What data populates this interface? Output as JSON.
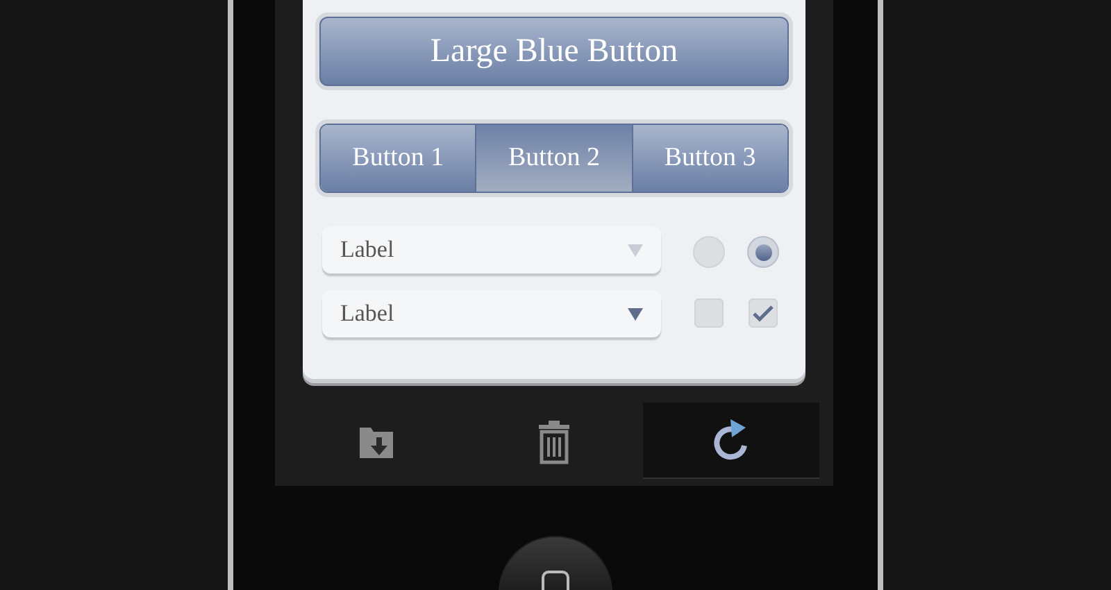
{
  "large_button": {
    "label": "Large Blue Button"
  },
  "segmented": [
    {
      "label": "Button 1",
      "selected": false
    },
    {
      "label": "Button 2",
      "selected": true
    },
    {
      "label": "Button 3",
      "selected": false
    }
  ],
  "dropdowns": [
    {
      "label": "Label",
      "disabled": true
    },
    {
      "label": "Label",
      "disabled": false
    }
  ],
  "radios": [
    {
      "selected": false
    },
    {
      "selected": true
    }
  ],
  "checkboxes": [
    {
      "checked": false
    },
    {
      "checked": true
    }
  ],
  "toolbar": [
    {
      "kind": "folder",
      "selected": false
    },
    {
      "kind": "trash",
      "selected": false
    },
    {
      "kind": "refresh",
      "selected": true
    }
  ]
}
